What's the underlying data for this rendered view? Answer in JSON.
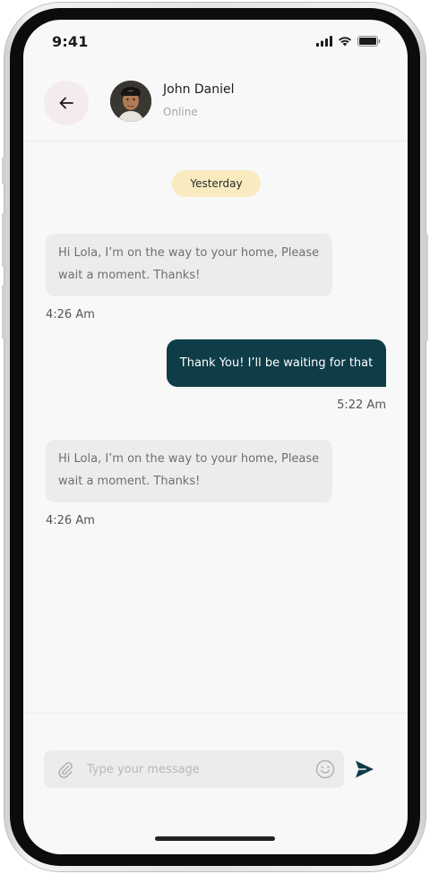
{
  "status_bar": {
    "time": "9:41"
  },
  "header": {
    "contact_name": "John Daniel",
    "contact_status": "Online"
  },
  "chat": {
    "date_separator": "Yesterday",
    "messages": [
      {
        "direction": "incoming",
        "line1": "Hi Lola, I’m on the way to your home, Please",
        "line2": "wait a moment. Thanks!",
        "time": "4:26 Am"
      },
      {
        "direction": "outgoing",
        "text": "Thank You! I’ll be waiting for that",
        "time": "5:22 Am"
      },
      {
        "direction": "incoming",
        "line1": "Hi Lola, I’m on the way to your home, Please",
        "line2": "wait a moment. Thanks!",
        "time": "4:26 Am"
      }
    ]
  },
  "composer": {
    "placeholder": "Type your message"
  },
  "colors": {
    "accent": "#0e3c47",
    "date_pill": "#f9ebbf",
    "incoming_bubble": "#ececec",
    "back_button_bg": "#f4ecec"
  },
  "icons": [
    "back-arrow-icon",
    "signal-icon",
    "wifi-icon",
    "battery-icon",
    "attach-icon",
    "emoji-icon",
    "send-icon"
  ]
}
